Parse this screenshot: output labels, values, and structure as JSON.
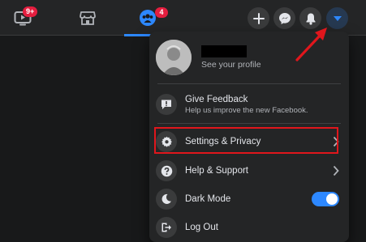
{
  "nav": {
    "watch_badge": "9+",
    "groups_badge": "4"
  },
  "profile": {
    "subtitle": "See your profile"
  },
  "menu": {
    "feedback_title": "Give Feedback",
    "feedback_subtitle": "Help us improve the new Facebook.",
    "settings_label": "Settings & Privacy",
    "help_label": "Help & Support",
    "dark_mode_label": "Dark Mode",
    "dark_mode_on": true,
    "logout_label": "Log Out"
  },
  "icons": [
    "watch-icon",
    "marketplace-icon",
    "groups-icon",
    "plus-icon",
    "messenger-icon",
    "bell-icon",
    "caret-down-icon",
    "feedback-icon",
    "gear-icon",
    "question-icon",
    "moon-icon",
    "logout-icon"
  ],
  "colors": {
    "accent": "#2d88ff",
    "badge": "#e41e3f",
    "annotation": "#e0161c"
  }
}
